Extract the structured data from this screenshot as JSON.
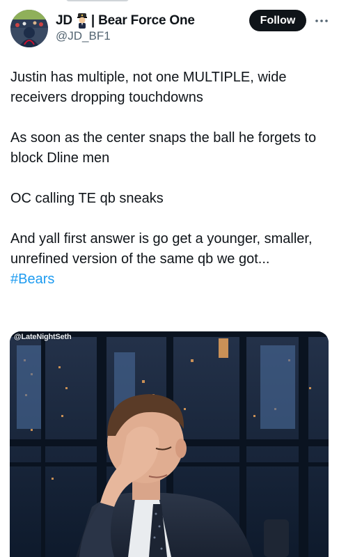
{
  "tweet": {
    "author": {
      "display_name": "JD",
      "name_suffix": "| Bear Force One",
      "handle": "@JD_BF1",
      "avatar_icon": "avatar-photo-icon",
      "badge_icon": "pilot-emoji-icon"
    },
    "follow_label": "Follow",
    "more_icon": "more-options-icon",
    "body": [
      "Justin has multiple, not one MULTIPLE, wide receivers dropping touchdowns",
      "As soon as the center snaps the ball he forgets to block Dline men",
      "OC calling TE qb sneaks",
      "And yall first answer is go get a younger, smaller, unrefined version of the same qb we got..."
    ],
    "hashtag": "#Bears",
    "media": {
      "watermark": "@LateNightSeth"
    }
  },
  "colors": {
    "text": "#0f1419",
    "secondary_text": "#536471",
    "link": "#1d9bf0",
    "follow_bg": "#0f1419"
  }
}
